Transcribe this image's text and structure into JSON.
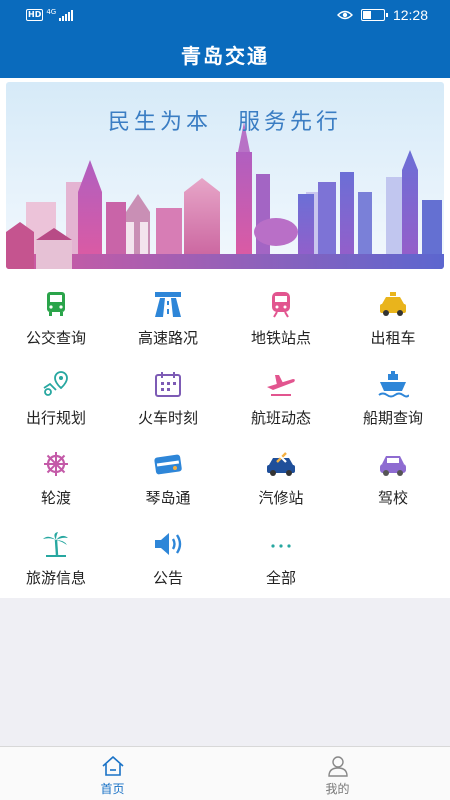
{
  "status_bar": {
    "hd_badge": "HD",
    "network": "4G",
    "time": "12:28"
  },
  "app": {
    "title": "青岛交通",
    "accent_color": "#0a6bbd"
  },
  "banner": {
    "slogan": "民生为本　服务先行"
  },
  "services": [
    {
      "label": "公交查询",
      "icon": "bus-icon",
      "color": "#2aa44a"
    },
    {
      "label": "高速路况",
      "icon": "highway-icon",
      "color": "#2e86d8"
    },
    {
      "label": "地铁站点",
      "icon": "subway-icon",
      "color": "#e2558f"
    },
    {
      "label": "出租车",
      "icon": "taxi-icon",
      "color": "#e9b41c"
    },
    {
      "label": "出行规划",
      "icon": "route-plan-icon",
      "color": "#27a7a0"
    },
    {
      "label": "火车时刻",
      "icon": "calendar-icon",
      "color": "#7d5bb5"
    },
    {
      "label": "航班动态",
      "icon": "airplane-icon",
      "color": "#e2558f"
    },
    {
      "label": "船期查询",
      "icon": "ship-icon",
      "color": "#2e86d8"
    },
    {
      "label": "轮渡",
      "icon": "ship-wheel-icon",
      "color": "#c45aa8"
    },
    {
      "label": "琴岛通",
      "icon": "card-icon",
      "color": "#2e86d8"
    },
    {
      "label": "汽修站",
      "icon": "car-repair-icon",
      "color": "#1f4f9a"
    },
    {
      "label": "驾校",
      "icon": "car-icon",
      "color": "#8e6bd1"
    },
    {
      "label": "旅游信息",
      "icon": "palm-tree-icon",
      "color": "#27a7a0"
    },
    {
      "label": "公告",
      "icon": "speaker-icon",
      "color": "#2e86d8"
    },
    {
      "label": "全部",
      "icon": "more-dots-icon",
      "color": "#27a7a0"
    }
  ],
  "tabs": [
    {
      "label": "首页",
      "icon": "home-icon",
      "active": true
    },
    {
      "label": "我的",
      "icon": "user-icon",
      "active": false
    }
  ]
}
